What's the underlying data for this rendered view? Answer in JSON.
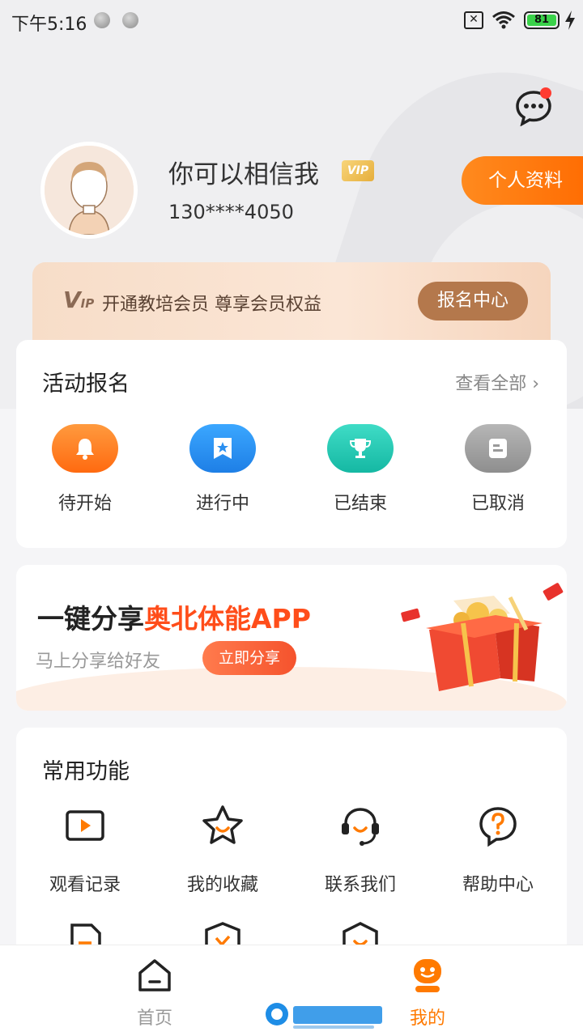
{
  "status": {
    "time": "下午5:16",
    "battery": "81",
    "sim": "✕"
  },
  "profile": {
    "name": "你可以相信我",
    "vip_badge": "VIP",
    "phone": "130****4050",
    "edit_label": "个人资料"
  },
  "vip_banner": {
    "logo": "V",
    "logo_sub": "IP",
    "text": "开通教培会员  尊享会员权益",
    "button": "报名中心"
  },
  "activity": {
    "title": "活动报名",
    "see_all": "查看全部 ›",
    "items": [
      {
        "label": "待开始",
        "icon": "bell-icon",
        "color": "#ff7a22"
      },
      {
        "label": "进行中",
        "icon": "bookmark-star-icon",
        "color": "#2a8ff0"
      },
      {
        "label": "已结束",
        "icon": "trophy-icon",
        "color": "#22c6b2"
      },
      {
        "label": "已取消",
        "icon": "note-icon",
        "color": "#9a9a9a"
      }
    ]
  },
  "share": {
    "title_prefix": "一键分享",
    "title_highlight": "奥北体能APP",
    "subtitle": "马上分享给好友",
    "button": "立即分享"
  },
  "common": {
    "title": "常用功能",
    "items": [
      {
        "label": "观看记录",
        "icon": "play-screen-icon"
      },
      {
        "label": "我的收藏",
        "icon": "star-icon"
      },
      {
        "label": "联系我们",
        "icon": "headset-icon"
      },
      {
        "label": "帮助中心",
        "icon": "help-icon"
      }
    ]
  },
  "tabs": [
    {
      "label": "首页",
      "icon": "home-icon",
      "active": false
    },
    {
      "label": "我的",
      "icon": "mine-icon",
      "active": true
    }
  ],
  "colors": {
    "accent": "#ff7a00",
    "vip_brown": "#b4784c",
    "share_red": "#ff4d1a"
  }
}
